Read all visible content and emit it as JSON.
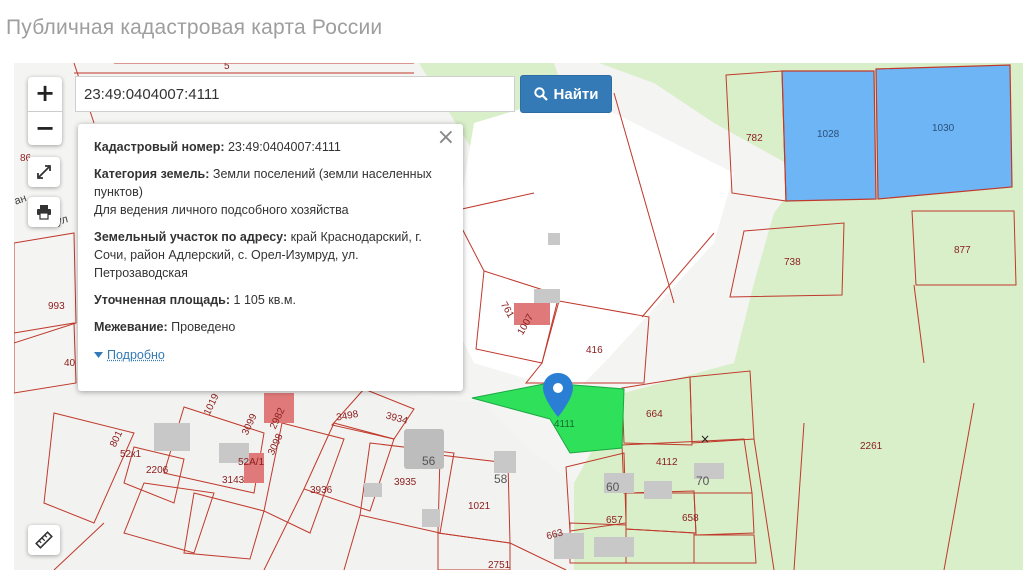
{
  "page": {
    "title": "Публичная кадастровая карта России"
  },
  "search": {
    "value": "23:49:0404007:4111",
    "button_label": "Найти"
  },
  "zoom": {
    "in": "+",
    "out": "−"
  },
  "info": {
    "cadastral_label": "Кадастровый номер:",
    "cadastral_value": "23:49:0404007:4111",
    "category_label": "Категория земель:",
    "category_value": "Земли поселений (земли населенных пунктов)",
    "category_use": "Для ведения личного подсобного хозяйства",
    "address_label": "Земельный участок по адресу:",
    "address_value": "край Краснодарский, г. Сочи, район Адлерский, с. Орел-Изумруд, ул. Петрозаводская",
    "area_label": "Уточненная площадь:",
    "area_value": "1 105 кв.м.",
    "survey_label": "Межевание:",
    "survey_value": "Проведено",
    "more_label": "Подробно"
  },
  "map": {
    "selected_label": "4111",
    "parcel_labels": {
      "p782": "782",
      "p1028": "1028",
      "p1030": "1030",
      "p738": "738",
      "p877": "877",
      "p993": "993",
      "p40": "40",
      "p761": "761",
      "p1007": "1007",
      "p416": "416",
      "p664": "664",
      "p4112": "4112",
      "p2261": "2261",
      "p3498": "3498",
      "p3934": "3934",
      "p1019": "1019",
      "p3099": "3099",
      "p2982": "2982",
      "p3098": "3098",
      "p801": "801",
      "p52k1": "52к1",
      "p2206": "2206",
      "p52a": "52А/1",
      "p3143": "3143",
      "p56": "56",
      "p3936": "3936",
      "p3935": "3935",
      "p58": "58",
      "p1021": "1021",
      "p60": "60",
      "p70": "70",
      "p657": "657",
      "p658": "658",
      "p663": "663",
      "p2751": "2751",
      "p8x": "86",
      "p5": "5"
    },
    "street_label": "ул",
    "street_label2": "ан",
    "colors": {
      "parcel_stroke": "#c0392b",
      "selected_fill": "#2ee05a",
      "blue_fill": "#6eb5f5",
      "green_area": "#d9efc9",
      "marker": "#2a7fd4"
    }
  }
}
